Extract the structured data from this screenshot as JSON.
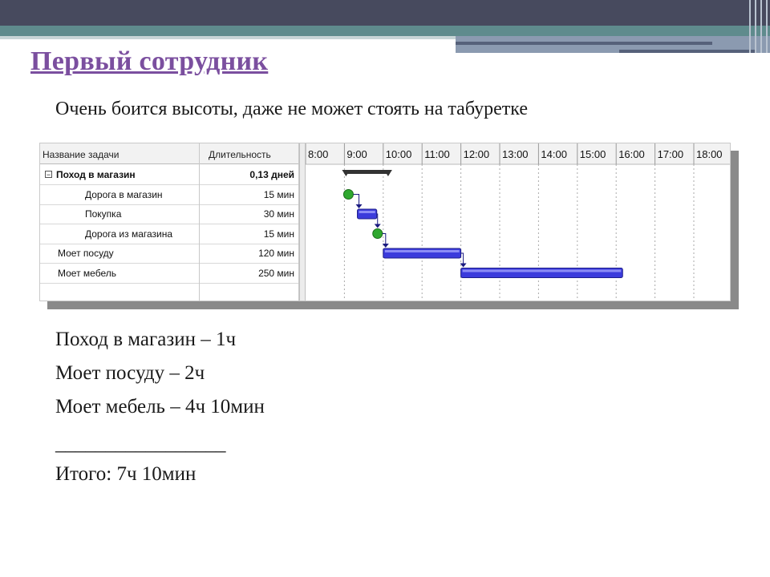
{
  "slide": {
    "title": "Первый сотрудник",
    "subtitle": "Очень боится высоты, даже не может стоять на табуретке",
    "summary_lines": [
      "Поход в магазин – 1ч",
      "Моет посуду – 2ч",
      "Моет мебель – 4ч 10мин",
      "_________________",
      "Итого: 7ч 10мин"
    ]
  },
  "gantt": {
    "columns": {
      "name": "Название задачи",
      "duration": "Длительность"
    },
    "hours": [
      "8:00",
      "9:00",
      "10:00",
      "11:00",
      "12:00",
      "13:00",
      "14:00",
      "15:00",
      "16:00",
      "17:00",
      "18:00"
    ],
    "tasks": [
      {
        "name": "Поход в магазин",
        "duration": "0,13 дней",
        "summary": true,
        "level": 0,
        "start": "9:00",
        "end": "10:10"
      },
      {
        "name": "Дорога в магазин",
        "duration": "15 мин",
        "level": 2,
        "start": "9:05",
        "end": "9:20",
        "milestone_like": true
      },
      {
        "name": "Покупка",
        "duration": "30 мин",
        "level": 2,
        "start": "9:20",
        "end": "9:50"
      },
      {
        "name": "Дорога из магазина",
        "duration": "15 мин",
        "level": 2,
        "start": "9:50",
        "end": "10:05",
        "milestone_like": true
      },
      {
        "name": "Моет посуду",
        "duration": "120 мин",
        "level": 1,
        "start": "10:00",
        "end": "12:00"
      },
      {
        "name": "Моет мебель",
        "duration": "250 мин",
        "level": 1,
        "start": "12:00",
        "end": "16:10"
      }
    ],
    "colors": {
      "bar": "#3b3bdc",
      "milestone": "#2fa82f",
      "summary": "#333333",
      "link": "#1a1a80"
    }
  }
}
